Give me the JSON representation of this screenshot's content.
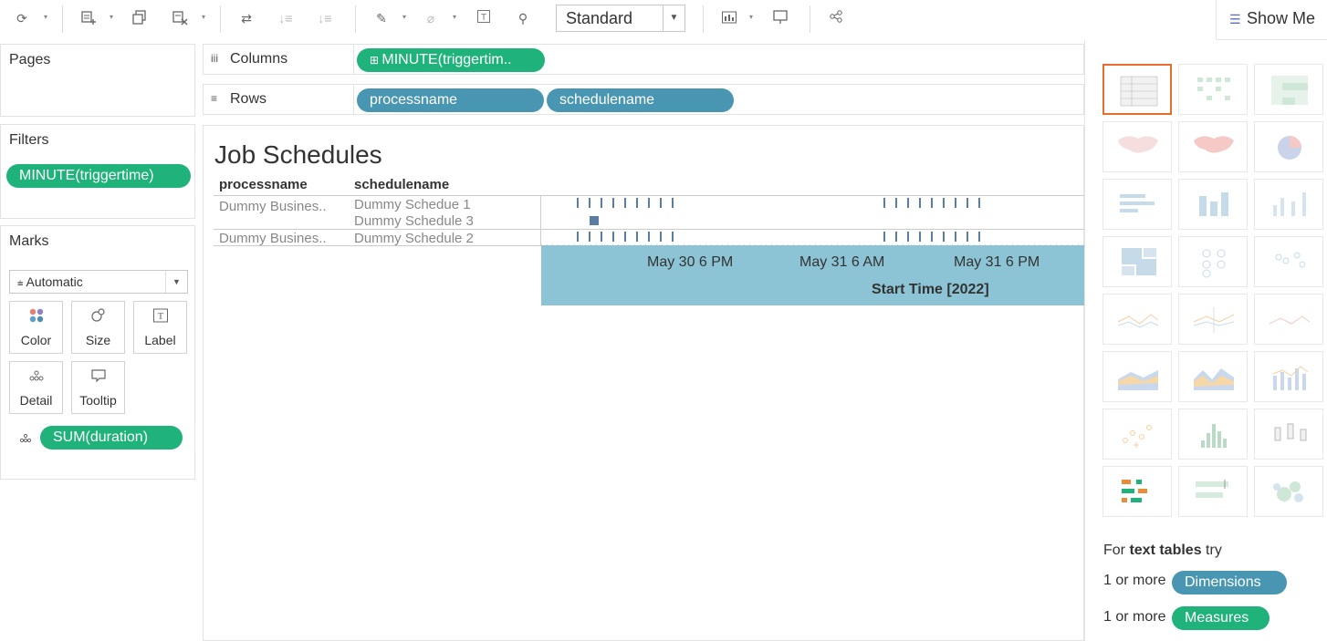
{
  "toolbar": {
    "icons": [
      "refresh-icon",
      "new-worksheet-icon",
      "duplicate-icon",
      "clear-sheet-icon",
      "swap-icon",
      "sort-ascending-icon",
      "sort-descending-icon",
      "highlight-icon",
      "group-icon",
      "show-labels-icon",
      "pin-icon",
      "show-me-chart-icon",
      "presentation-icon",
      "share-icon"
    ],
    "fit_select": "Standard",
    "show_me_label": "Show Me"
  },
  "pages_panel": {
    "title": "Pages"
  },
  "filters_panel": {
    "title": "Filters",
    "pills": [
      "MINUTE(triggertime)"
    ]
  },
  "marks_panel": {
    "title": "Marks",
    "mark_type": "Automatic",
    "buttons": [
      {
        "label": "Color",
        "icon": "color-icon"
      },
      {
        "label": "Size",
        "icon": "size-icon"
      },
      {
        "label": "Label",
        "icon": "label-icon"
      },
      {
        "label": "Detail",
        "icon": "detail-icon"
      },
      {
        "label": "Tooltip",
        "icon": "tooltip-icon"
      }
    ],
    "field_pill": "SUM(duration)"
  },
  "shelves": {
    "columns": {
      "label": "Columns",
      "pills": [
        "MINUTE(triggertim.."
      ]
    },
    "rows": {
      "label": "Rows",
      "pills": [
        "processname",
        "schedulename"
      ]
    }
  },
  "view": {
    "title": "Job Schedules",
    "headers": [
      "processname",
      "schedulename"
    ],
    "rows": [
      {
        "process": "Dummy Busines..",
        "schedule": "Dummy Schedue 1"
      },
      {
        "process": "",
        "schedule": "Dummy Schedule 3"
      },
      {
        "process": "Dummy Busines..",
        "schedule": "Dummy Schedule 2"
      }
    ],
    "axis": {
      "ticks": [
        "May 30 6 PM",
        "May 31 6 AM",
        "May 31 6 PM"
      ],
      "title": "Start Time [2022]",
      "band_color": "#8cc4d6",
      "mark_color": "#2f5d8a"
    }
  },
  "show_me": {
    "tiles": [
      "text-table",
      "heat-map",
      "highlight-table",
      "symbol-map",
      "filled-map",
      "pie-chart",
      "horizontal-bars",
      "stacked-bars",
      "side-by-side-bars",
      "treemap",
      "circle-views",
      "side-by-side-circles",
      "lines-discrete",
      "lines-continuous",
      "dual-lines",
      "area-discrete",
      "area-continuous",
      "dual-combination",
      "scatter-plot",
      "histogram",
      "box-and-whisker",
      "gantt-chart",
      "bullet-graph",
      "packed-bubbles"
    ],
    "selected_tile": "text-table",
    "hint_prefix": "For ",
    "hint_bold": "text tables",
    "hint_suffix": " try",
    "dimensions_prefix": "1 or more",
    "dimensions_pill": "Dimensions",
    "measures_prefix": "1 or more",
    "measures_pill": "Measures",
    "accent": "#e86c2c"
  }
}
